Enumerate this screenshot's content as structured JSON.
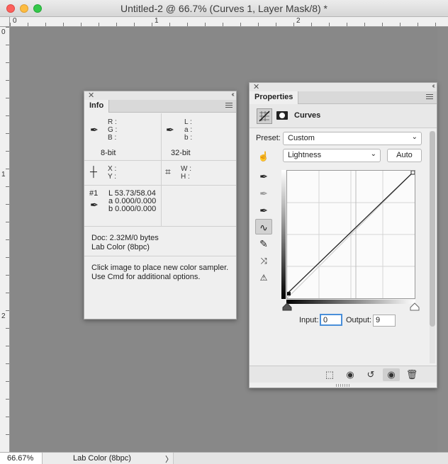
{
  "window": {
    "title": "Untitled-2 @ 66.7% (Curves 1, Layer Mask/8) *"
  },
  "rulers": {
    "top": [
      "0",
      "1",
      "2"
    ],
    "left": [
      "0",
      "1",
      "2"
    ]
  },
  "info_panel": {
    "tab": "Info",
    "rgb_labels": "R :\nG :\nB :",
    "rgb_bits": "8-bit",
    "lab_labels": "L :\na :\nb :",
    "lab_bits": "32-bit",
    "xy_labels": "X :\nY :",
    "wh_labels": "W :\nH :",
    "sampler_id": "#1",
    "sampler_L": "L  53.73/58.04",
    "sampler_a": "a  0.000/0.000",
    "sampler_b": "b  0.000/0.000",
    "doc": "Doc: 2.32M/0 bytes",
    "mode": "Lab Color (8bpc)",
    "hint_line1": "Click image to place new color sampler.",
    "hint_line2": "Use Cmd for additional options."
  },
  "properties_panel": {
    "tab": "Properties",
    "adjustment_name": "Curves",
    "preset_label": "Preset:",
    "preset_value": "Custom",
    "channel_value": "Lightness",
    "auto_label": "Auto",
    "input_label": "Input:",
    "input_value": "0",
    "output_label": "Output:",
    "output_value": "9"
  },
  "curve": {
    "points": [
      [
        0,
        9
      ],
      [
        255,
        255
      ]
    ],
    "range": [
      0,
      255
    ]
  },
  "status_bar": {
    "zoom": "66.67%",
    "doc_info": "Lab Color (8bpc)"
  }
}
